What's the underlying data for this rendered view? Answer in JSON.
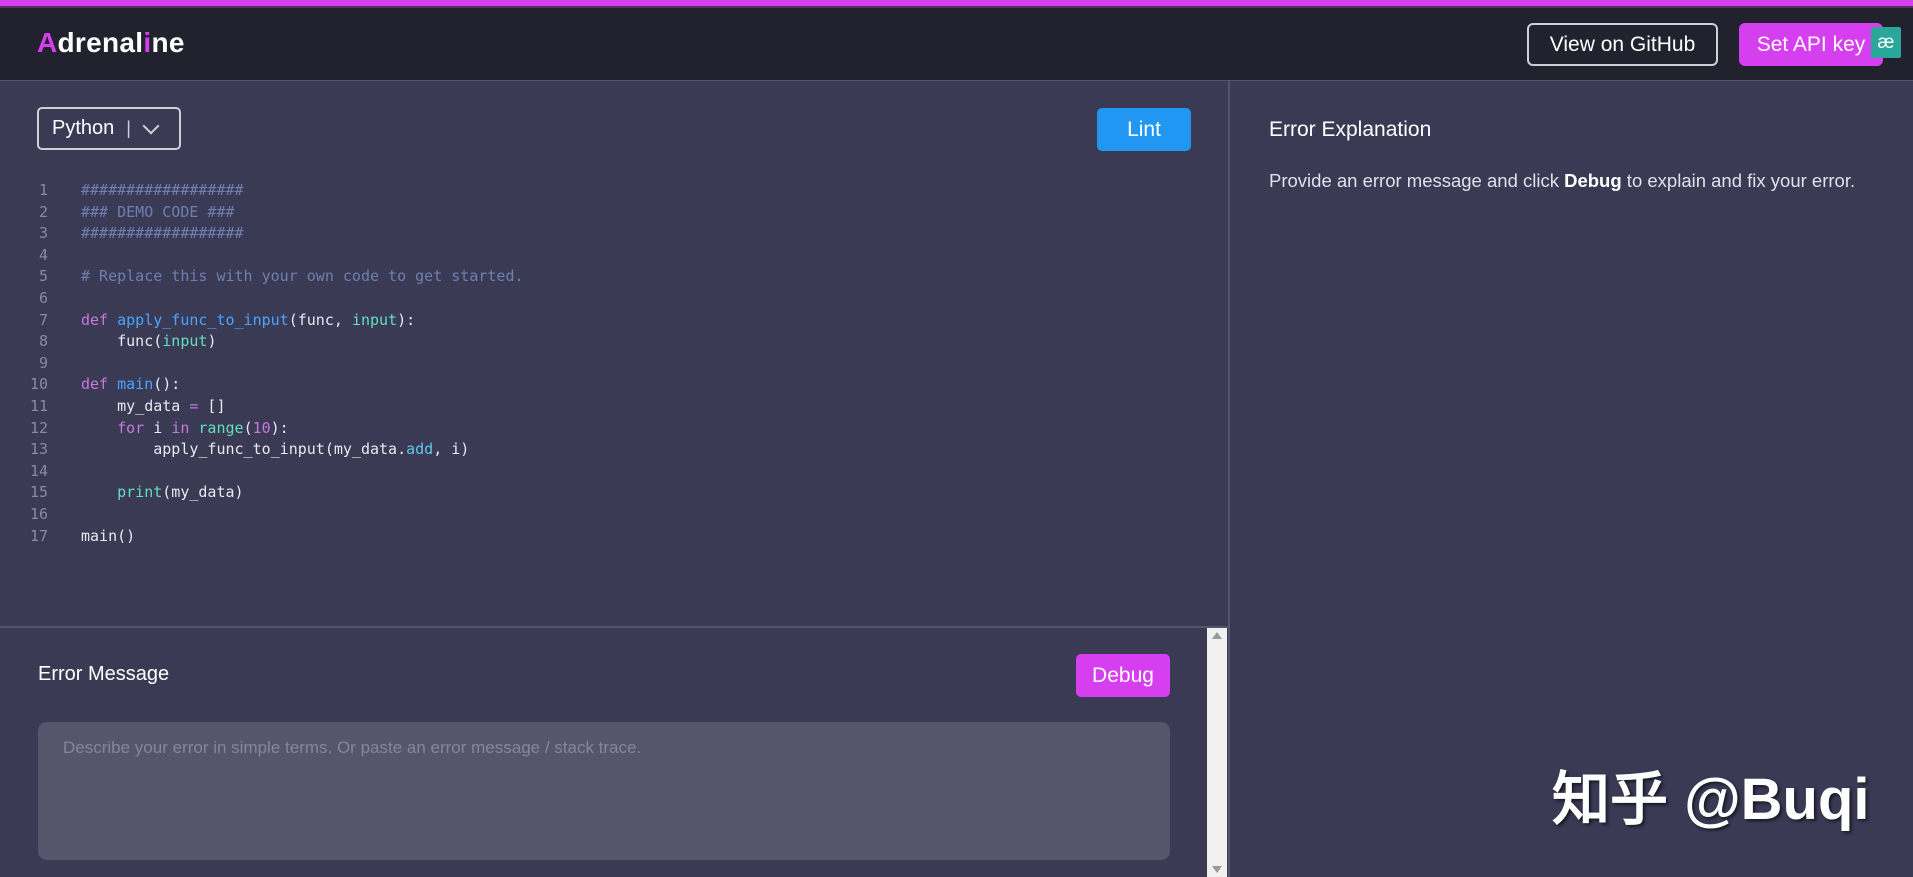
{
  "header": {
    "logo_a": "A",
    "logo_mid": "drenal",
    "logo_i": "i",
    "logo_end": "ne",
    "github_label": "View on GitHub",
    "api_label": "Set API key",
    "extension_badge": "æ"
  },
  "editor": {
    "language": "Python",
    "separator": "|",
    "lint_label": "Lint",
    "lines": [
      {
        "n": "1",
        "tokens": [
          {
            "t": "##################",
            "c": "comment"
          }
        ]
      },
      {
        "n": "2",
        "tokens": [
          {
            "t": "### DEMO CODE ###",
            "c": "comment"
          }
        ]
      },
      {
        "n": "3",
        "tokens": [
          {
            "t": "##################",
            "c": "comment"
          }
        ]
      },
      {
        "n": "4",
        "tokens": []
      },
      {
        "n": "5",
        "tokens": [
          {
            "t": "# Replace this with your own code to get started.",
            "c": "comment"
          }
        ]
      },
      {
        "n": "6",
        "tokens": []
      },
      {
        "n": "7",
        "tokens": [
          {
            "t": "def ",
            "c": "kw"
          },
          {
            "t": "apply_func_to_input",
            "c": "fn"
          },
          {
            "t": "(func, ",
            "c": "plain"
          },
          {
            "t": "input",
            "c": "param"
          },
          {
            "t": "):",
            "c": "plain"
          }
        ]
      },
      {
        "n": "8",
        "tokens": [
          {
            "t": "    func(",
            "c": "plain"
          },
          {
            "t": "input",
            "c": "param"
          },
          {
            "t": ")",
            "c": "plain"
          }
        ]
      },
      {
        "n": "9",
        "tokens": []
      },
      {
        "n": "10",
        "tokens": [
          {
            "t": "def ",
            "c": "kw"
          },
          {
            "t": "main",
            "c": "fn"
          },
          {
            "t": "():",
            "c": "plain"
          }
        ]
      },
      {
        "n": "11",
        "tokens": [
          {
            "t": "    my_data ",
            "c": "plain"
          },
          {
            "t": "=",
            "c": "op"
          },
          {
            "t": " []",
            "c": "plain"
          }
        ]
      },
      {
        "n": "12",
        "tokens": [
          {
            "t": "    ",
            "c": "plain"
          },
          {
            "t": "for",
            "c": "kw"
          },
          {
            "t": " i ",
            "c": "plain"
          },
          {
            "t": "in",
            "c": "kw"
          },
          {
            "t": " ",
            "c": "plain"
          },
          {
            "t": "range",
            "c": "param"
          },
          {
            "t": "(",
            "c": "plain"
          },
          {
            "t": "10",
            "c": "num"
          },
          {
            "t": "):",
            "c": "plain"
          }
        ]
      },
      {
        "n": "13",
        "tokens": [
          {
            "t": "        apply_func_to_input(my_data.",
            "c": "plain"
          },
          {
            "t": "add",
            "c": "attr"
          },
          {
            "t": ", i)",
            "c": "plain"
          }
        ]
      },
      {
        "n": "14",
        "tokens": []
      },
      {
        "n": "15",
        "tokens": [
          {
            "t": "    ",
            "c": "plain"
          },
          {
            "t": "print",
            "c": "param"
          },
          {
            "t": "(my_data)",
            "c": "plain"
          }
        ]
      },
      {
        "n": "16",
        "tokens": []
      },
      {
        "n": "17",
        "tokens": [
          {
            "t": "main()",
            "c": "plain"
          }
        ]
      }
    ]
  },
  "error_panel": {
    "title": "Error Message",
    "debug_label": "Debug",
    "placeholder": "Describe your error in simple terms. Or paste an error message / stack trace."
  },
  "explanation": {
    "title": "Error Explanation",
    "text_before": "Provide an error message and click ",
    "text_bold": "Debug",
    "text_after": " to explain and fix your error."
  },
  "watermark": "知乎 @Buqi",
  "colors": {
    "accent_magenta": "#d63ff0",
    "accent_blue": "#2196f3",
    "header_bg": "#22222f",
    "panel_bg": "#3a3a55"
  }
}
